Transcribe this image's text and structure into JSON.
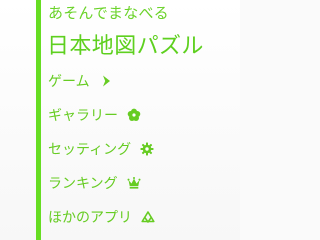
{
  "header": {
    "subtitle": "あそんでまなべる",
    "title": "日本地図パズル"
  },
  "menu": {
    "items": [
      {
        "label": "ゲーム",
        "icon": "chevron-right-icon"
      },
      {
        "label": "ギャラリー",
        "icon": "flower-icon"
      },
      {
        "label": "セッティング",
        "icon": "gear-icon"
      },
      {
        "label": "ランキング",
        "icon": "crown-icon"
      },
      {
        "label": "ほかのアプリ",
        "icon": "apps-icon"
      }
    ]
  },
  "colors": {
    "accent": "#66dd22",
    "text": "#66cc22",
    "background": "#fafafa"
  }
}
